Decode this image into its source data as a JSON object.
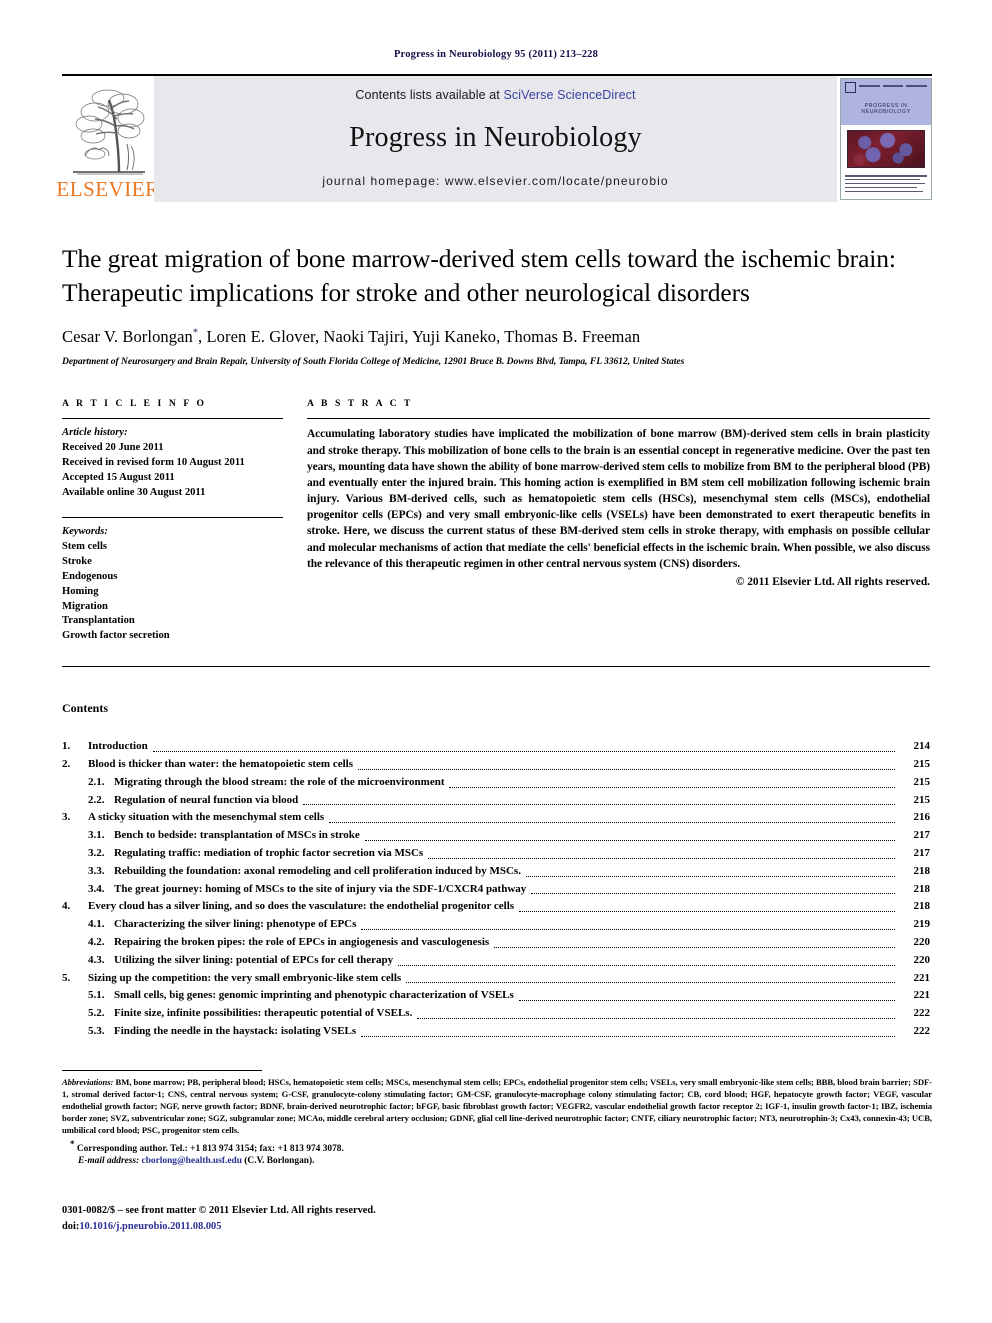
{
  "running_head": "Progress in Neurobiology 95 (2011) 213–228",
  "masthead": {
    "publisher_wordmark": "ELSEVIER",
    "contents_lists_prefix": "Contents lists available at ",
    "contents_lists_link": "SciVerse ScienceDirect",
    "journal_name": "Progress in Neurobiology",
    "journal_homepage": "journal homepage: www.elsevier.com/locate/pneurobio",
    "cover_title": "PROGRESS IN NEUROBIOLOGY"
  },
  "article": {
    "title": "The great migration of bone marrow-derived stem cells toward the ischemic brain: Therapeutic implications for stroke and other neurological disorders",
    "authors": "Cesar V. Borlongan",
    "authors_rest": ", Loren E. Glover, Naoki Tajiri, Yuji Kaneko, Thomas B. Freeman",
    "corresponding_marker": "*",
    "affiliation": "Department of Neurosurgery and Brain Repair, University of South Florida College of Medicine, 12901 Bruce B. Downs Blvd, Tampa, FL 33612, United States"
  },
  "article_info": {
    "heading": "A R T I C L E   I N F O",
    "history_label": "Article history:",
    "history": [
      "Received 20 June 2011",
      "Received in revised form 10 August 2011",
      "Accepted 15 August 2011",
      "Available online 30 August 2011"
    ],
    "keywords_label": "Keywords:",
    "keywords": [
      "Stem cells",
      "Stroke",
      "Endogenous",
      "Homing",
      "Migration",
      "Transplantation",
      "Growth factor secretion"
    ]
  },
  "abstract": {
    "heading": "A B S T R A C T",
    "text": "Accumulating laboratory studies have implicated the mobilization of bone marrow (BM)-derived stem cells in brain plasticity and stroke therapy. This mobilization of bone cells to the brain is an essential concept in regenerative medicine. Over the past ten years, mounting data have shown the ability of bone marrow-derived stem cells to mobilize from BM to the peripheral blood (PB) and eventually enter the injured brain. This homing action is exemplified in BM stem cell mobilization following ischemic brain injury. Various BM-derived cells, such as hematopoietic stem cells (HSCs), mesenchymal stem cells (MSCs), endothelial progenitor cells (EPCs) and very small embryonic-like cells (VSELs) have been demonstrated to exert therapeutic benefits in stroke. Here, we discuss the current status of these BM-derived stem cells in stroke therapy, with emphasis on possible cellular and molecular mechanisms of action that mediate the cells' beneficial effects in the ischemic brain. When possible, we also discuss the relevance of this therapeutic regimen in other central nervous system (CNS) disorders.",
    "copyright": "© 2011 Elsevier Ltd. All rights reserved."
  },
  "contents": {
    "heading": "Contents",
    "entries": [
      {
        "number": "1.",
        "sub": "",
        "label": "Introduction",
        "page": "214"
      },
      {
        "number": "2.",
        "sub": "",
        "label": "Blood is thicker than water: the hematopoietic stem cells",
        "page": "215"
      },
      {
        "number": "",
        "sub": "2.1.",
        "label": "Migrating through the blood stream: the role of the microenvironment",
        "page": "215"
      },
      {
        "number": "",
        "sub": "2.2.",
        "label": "Regulation of neural function via blood",
        "page": "215"
      },
      {
        "number": "3.",
        "sub": "",
        "label": "A sticky situation with the mesenchymal stem cells",
        "page": "216"
      },
      {
        "number": "",
        "sub": "3.1.",
        "label": "Bench to bedside: transplantation of MSCs in stroke",
        "page": "217"
      },
      {
        "number": "",
        "sub": "3.2.",
        "label": "Regulating traffic: mediation of trophic factor secretion via MSCs",
        "page": "217"
      },
      {
        "number": "",
        "sub": "3.3.",
        "label": "Rebuilding the foundation: axonal remodeling and cell proliferation induced by MSCs.",
        "page": "218"
      },
      {
        "number": "",
        "sub": "3.4.",
        "label": "The great journey: homing of MSCs to the site of injury via the SDF-1/CXCR4 pathway",
        "page": "218"
      },
      {
        "number": "4.",
        "sub": "",
        "label": "Every cloud has a silver lining, and so does the vasculature: the endothelial progenitor cells",
        "page": "218"
      },
      {
        "number": "",
        "sub": "4.1.",
        "label": "Characterizing the silver lining: phenotype of EPCs",
        "page": "219"
      },
      {
        "number": "",
        "sub": "4.2.",
        "label": "Repairing the broken pipes: the role of EPCs in angiogenesis and vasculogenesis",
        "page": "220"
      },
      {
        "number": "",
        "sub": "4.3.",
        "label": "Utilizing the silver lining: potential of EPCs for cell therapy",
        "page": "220"
      },
      {
        "number": "5.",
        "sub": "",
        "label": "Sizing up the competition: the very small embryonic-like stem cells",
        "page": "221"
      },
      {
        "number": "",
        "sub": "5.1.",
        "label": "Small cells, big genes: genomic imprinting and phenotypic characterization of VSELs",
        "page": "221"
      },
      {
        "number": "",
        "sub": "5.2.",
        "label": "Finite size, infinite possibilities: therapeutic potential of VSELs.",
        "page": "222"
      },
      {
        "number": "",
        "sub": "5.3.",
        "label": "Finding the needle in the haystack: isolating VSELs",
        "page": "222"
      }
    ]
  },
  "footnotes": {
    "abbreviations_label": "Abbreviations:",
    "abbreviations_text": " BM, bone marrow; PB, peripheral blood; HSCs, hematopoietic stem cells; MSCs, mesenchymal stem cells; EPCs, endothelial progenitor stem cells; VSELs, very small embryonic-like stem cells; BBB, blood brain barrier; SDF-1, stromal derived factor-1; CNS, central nervous system; G-CSF, granulocyte-colony stimulating factor; GM-CSF, granulocyte-macrophage colony stimulating factor; CB, cord blood; HGF, hepatocyte growth factor; VEGF, vascular endothelial growth factor; NGF, nerve growth factor; BDNF, brain-derived neurotrophic factor; bFGF, basic fibroblast growth factor; VEGFR2, vascular endothelial growth factor receptor 2; IGF-1, insulin growth factor-1; IBZ, ischemia border zone; SVZ, subventricular zone; SGZ, subgranular zone; MCAo, middle cerebral artery occlusion; GDNF, glial cell line-derived neurotrophic factor; CNTF, ciliary neurotrophic factor; NT3, neurotrophin-3; Cx43, connexin-43; UCB, umbilical cord blood; PSC, progenitor stem cells.",
    "corresponding_marker": "*",
    "corresponding_text": " Corresponding author. Tel.: +1 813 974 3154; fax: +1 813 974 3078.",
    "email_label": "E-mail address:",
    "email_link": "cborlong@health.usf.edu",
    "email_suffix": " (C.V. Borlongan)."
  },
  "footer": {
    "front_matter": "0301-0082/$ – see front matter © 2011 Elsevier Ltd. All rights reserved.",
    "doi_prefix": "doi:",
    "doi_link": "10.1016/j.pneurobio.2011.08.005"
  },
  "colors": {
    "link": "#2a2f94",
    "elsevier_orange": "#E87722",
    "banner_bg": "#e7e7ec",
    "runhead": "#12114a"
  }
}
